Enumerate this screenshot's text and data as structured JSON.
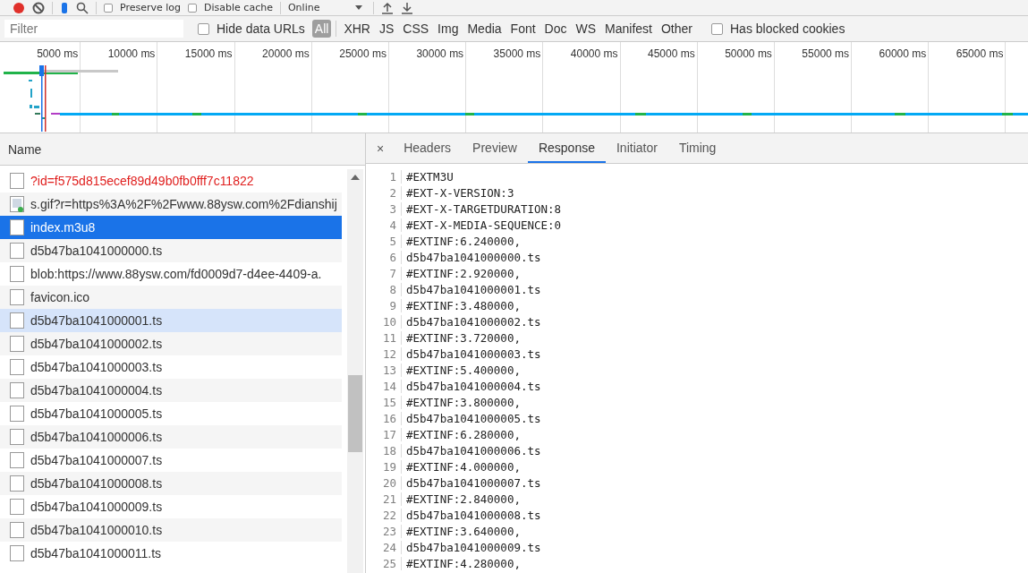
{
  "toolbar": {
    "preserve_log": {
      "label": "Preserve log",
      "checked": false
    },
    "disable_cache": {
      "label": "Disable cache",
      "checked": false
    },
    "throttling": "Online"
  },
  "filter_bar": {
    "placeholder": "Filter",
    "hide_data_urls": {
      "label": "Hide data URLs",
      "checked": false
    },
    "types": [
      {
        "label": "All",
        "selected": true
      },
      {
        "label": "XHR",
        "selected": false
      },
      {
        "label": "JS",
        "selected": false
      },
      {
        "label": "CSS",
        "selected": false
      },
      {
        "label": "Img",
        "selected": false
      },
      {
        "label": "Media",
        "selected": false
      },
      {
        "label": "Font",
        "selected": false
      },
      {
        "label": "Doc",
        "selected": false
      },
      {
        "label": "WS",
        "selected": false
      },
      {
        "label": "Manifest",
        "selected": false
      },
      {
        "label": "Other",
        "selected": false
      }
    ],
    "blocked_cookies": {
      "label": "Has blocked cookies",
      "checked": false
    }
  },
  "timeline": {
    "ticks": [
      "5000 ms",
      "10000 ms",
      "15000 ms",
      "20000 ms",
      "25000 ms",
      "30000 ms",
      "35000 ms",
      "40000 ms",
      "45000 ms",
      "50000 ms",
      "55000 ms",
      "60000 ms",
      "65000 ms"
    ]
  },
  "requests": {
    "column": "Name",
    "rows": [
      {
        "name": "?id=f575d815ecef89d49b0fb0fff7c11822",
        "kind": "error",
        "selected": false,
        "hovered": false
      },
      {
        "name": "s.gif?r=https%3A%2F%2Fwww.88ysw.com%2Fdianshij",
        "kind": "image",
        "selected": false,
        "hovered": false
      },
      {
        "name": "index.m3u8",
        "kind": "document",
        "selected": true,
        "hovered": false
      },
      {
        "name": "d5b47ba1041000000.ts",
        "kind": "document",
        "selected": false,
        "hovered": false
      },
      {
        "name": "blob:https://www.88ysw.com/fd0009d7-d4ee-4409-a.",
        "kind": "document",
        "selected": false,
        "hovered": false
      },
      {
        "name": "favicon.ico",
        "kind": "document",
        "selected": false,
        "hovered": false
      },
      {
        "name": "d5b47ba1041000001.ts",
        "kind": "document",
        "selected": false,
        "hovered": true
      },
      {
        "name": "d5b47ba1041000002.ts",
        "kind": "document",
        "selected": false,
        "hovered": false
      },
      {
        "name": "d5b47ba1041000003.ts",
        "kind": "document",
        "selected": false,
        "hovered": false
      },
      {
        "name": "d5b47ba1041000004.ts",
        "kind": "document",
        "selected": false,
        "hovered": false
      },
      {
        "name": "d5b47ba1041000005.ts",
        "kind": "document",
        "selected": false,
        "hovered": false
      },
      {
        "name": "d5b47ba1041000006.ts",
        "kind": "document",
        "selected": false,
        "hovered": false
      },
      {
        "name": "d5b47ba1041000007.ts",
        "kind": "document",
        "selected": false,
        "hovered": false
      },
      {
        "name": "d5b47ba1041000008.ts",
        "kind": "document",
        "selected": false,
        "hovered": false
      },
      {
        "name": "d5b47ba1041000009.ts",
        "kind": "document",
        "selected": false,
        "hovered": false
      },
      {
        "name": "d5b47ba1041000010.ts",
        "kind": "document",
        "selected": false,
        "hovered": false
      },
      {
        "name": "d5b47ba1041000011.ts",
        "kind": "document",
        "selected": false,
        "hovered": false
      }
    ]
  },
  "details": {
    "close": "×",
    "tabs": [
      {
        "label": "Headers",
        "selected": false
      },
      {
        "label": "Preview",
        "selected": false
      },
      {
        "label": "Response",
        "selected": true
      },
      {
        "label": "Initiator",
        "selected": false
      },
      {
        "label": "Timing",
        "selected": false
      }
    ],
    "lines": [
      {
        "no": "1",
        "text": "#EXTM3U"
      },
      {
        "no": "2",
        "text": "#EXT-X-VERSION:3"
      },
      {
        "no": "3",
        "text": "#EXT-X-TARGETDURATION:8"
      },
      {
        "no": "4",
        "text": "#EXT-X-MEDIA-SEQUENCE:0"
      },
      {
        "no": "5",
        "text": "#EXTINF:6.240000,"
      },
      {
        "no": "6",
        "text": "d5b47ba1041000000.ts"
      },
      {
        "no": "7",
        "text": "#EXTINF:2.920000,"
      },
      {
        "no": "8",
        "text": "d5b47ba1041000001.ts"
      },
      {
        "no": "9",
        "text": "#EXTINF:3.480000,"
      },
      {
        "no": "10",
        "text": "d5b47ba1041000002.ts"
      },
      {
        "no": "11",
        "text": "#EXTINF:3.720000,"
      },
      {
        "no": "12",
        "text": "d5b47ba1041000003.ts"
      },
      {
        "no": "13",
        "text": "#EXTINF:5.400000,"
      },
      {
        "no": "14",
        "text": "d5b47ba1041000004.ts"
      },
      {
        "no": "15",
        "text": "#EXTINF:3.800000,"
      },
      {
        "no": "16",
        "text": "d5b47ba1041000005.ts"
      },
      {
        "no": "17",
        "text": "#EXTINF:6.280000,"
      },
      {
        "no": "18",
        "text": "d5b47ba1041000006.ts"
      },
      {
        "no": "19",
        "text": "#EXTINF:4.000000,"
      },
      {
        "no": "20",
        "text": "d5b47ba1041000007.ts"
      },
      {
        "no": "21",
        "text": "#EXTINF:2.840000,"
      },
      {
        "no": "22",
        "text": "d5b47ba1041000008.ts"
      },
      {
        "no": "23",
        "text": "#EXTINF:3.640000,"
      },
      {
        "no": "24",
        "text": "d5b47ba1041000009.ts"
      },
      {
        "no": "25",
        "text": "#EXTINF:4.280000,"
      }
    ]
  }
}
